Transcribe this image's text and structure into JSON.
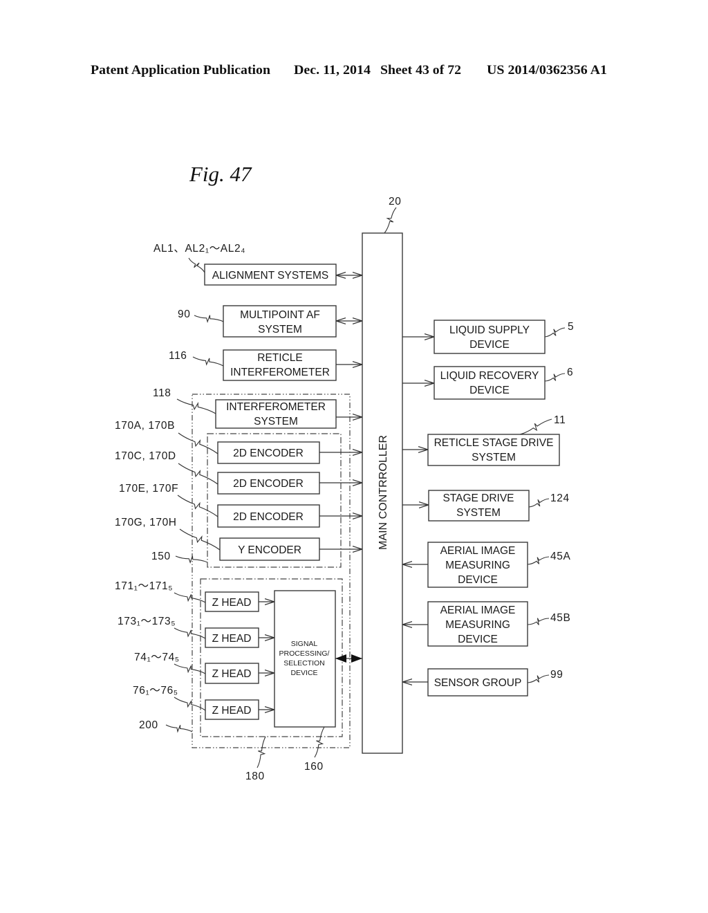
{
  "header": {
    "publication": "Patent Application Publication",
    "date": "Dec. 11, 2014",
    "sheet": "Sheet 43 of 72",
    "number": "US 2014/0362356 A1"
  },
  "figure": {
    "title": "Fig. 47"
  },
  "main_controller": {
    "label": "MAIN CONTRROLLER",
    "ref": "20"
  },
  "left_blocks": {
    "alignment_systems": {
      "lines": [
        "ALIGNMENT SYSTEMS"
      ],
      "ref": "AL1、AL2₁～AL2₄"
    },
    "multipoint_af": {
      "lines": [
        "MULTIPOINT AF",
        "SYSTEM"
      ],
      "ref": "90"
    },
    "reticle_interferometer": {
      "lines": [
        "RETICLE",
        "INTERFEROMETER"
      ],
      "ref": "116"
    },
    "interferometer_system": {
      "lines": [
        "INTERFEROMETER",
        "SYSTEM"
      ],
      "ref": "118"
    }
  },
  "measurement_system": {
    "ref": "200"
  },
  "encoder_system": {
    "ref": "150",
    "encoders": [
      {
        "label": "2D ENCODER",
        "ref": "170A, 170B"
      },
      {
        "label": "2D ENCODER",
        "ref": "170C, 170D"
      },
      {
        "label": "2D ENCODER",
        "ref": "170E, 170F"
      },
      {
        "label": "Y ENCODER",
        "ref": "170G, 170H"
      }
    ]
  },
  "z_head_system": {
    "ref": "180",
    "heads": [
      {
        "label": "Z HEAD",
        "ref": "171₁～171₅"
      },
      {
        "label": "Z HEAD",
        "ref": "173₁～173₅"
      },
      {
        "label": "Z HEAD",
        "ref": "74₁～74₅"
      },
      {
        "label": "Z HEAD",
        "ref": "76₁～76₅"
      }
    ]
  },
  "signal_processing": {
    "lines": [
      "SIGNAL",
      "PROCESSING/",
      "SELECTION",
      "DEVICE"
    ],
    "ref": "160"
  },
  "right_blocks": {
    "liquid_supply": {
      "lines": [
        "LIQUID SUPPLY",
        "DEVICE"
      ],
      "ref": "5"
    },
    "liquid_recovery": {
      "lines": [
        "LIQUID RECOVERY",
        "DEVICE"
      ],
      "ref": "6"
    },
    "reticle_stage_drive": {
      "lines": [
        "RETICLE STAGE DRIVE",
        "SYSTEM"
      ],
      "ref": "11"
    },
    "stage_drive": {
      "lines": [
        "STAGE DRIVE",
        "SYSTEM"
      ],
      "ref": "124"
    },
    "aerial_image_a": {
      "lines": [
        "AERIAL IMAGE",
        "MEASURING",
        "DEVICE"
      ],
      "ref": "45A"
    },
    "aerial_image_b": {
      "lines": [
        "AERIAL IMAGE",
        "MEASURING",
        "DEVICE"
      ],
      "ref": "45B"
    },
    "sensor_group": {
      "lines": [
        "SENSOR GROUP"
      ],
      "ref": "99"
    }
  }
}
